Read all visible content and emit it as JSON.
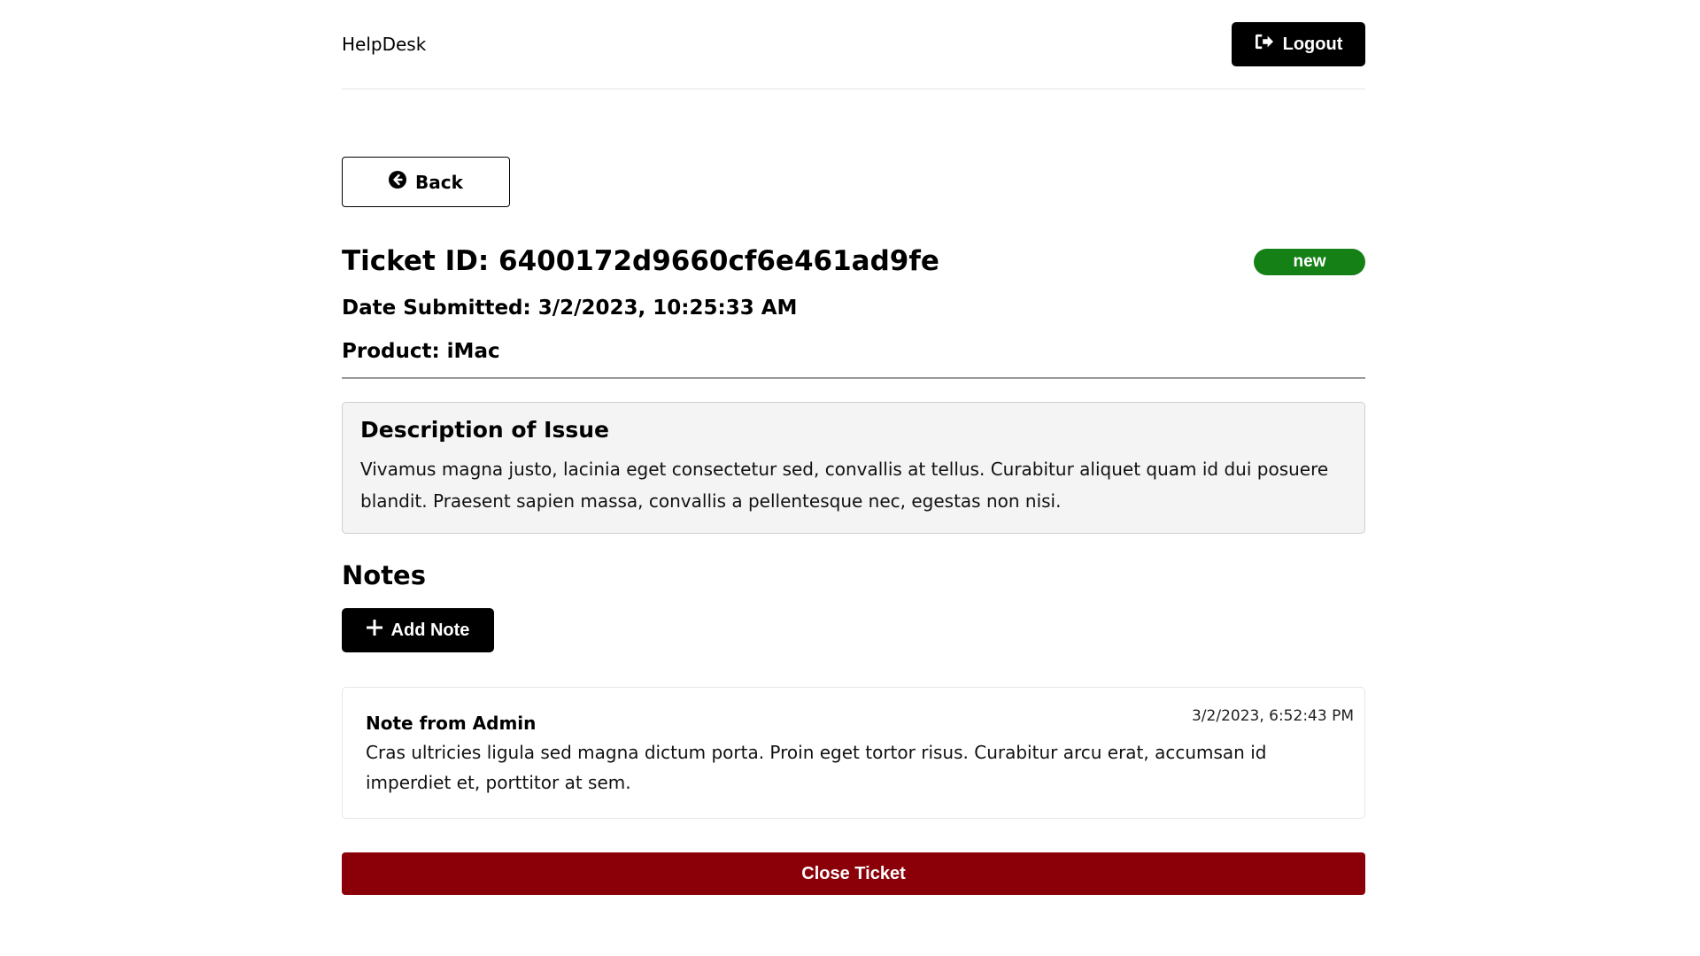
{
  "header": {
    "brand": "HelpDesk",
    "logout_label": "Logout",
    "logout_icon": "sign-out-icon"
  },
  "back": {
    "label": "Back",
    "icon": "arrow-circle-left-icon"
  },
  "ticket": {
    "id_text": "Ticket ID: 6400172d9660cf6e461ad9fe",
    "status": "new",
    "status_color": "#158016",
    "date_text": "Date Submitted: 3/2/2023, 10:25:33 AM",
    "product_text": "Product: iMac"
  },
  "description": {
    "title": "Description of Issue",
    "text": "Vivamus magna justo, lacinia eget consectetur sed, convallis at tellus. Curabitur aliquet quam id dui posuere blandit. Praesent sapien massa, convallis a pellentesque nec, egestas non nisi."
  },
  "notes": {
    "title": "Notes",
    "add_label": "Add Note",
    "add_icon": "plus-icon",
    "items": [
      {
        "author": "Note from Admin",
        "date": "3/2/2023, 6:52:43 PM",
        "text": "Cras ultricies ligula sed magna dictum porta. Proin eget tortor risus. Curabitur arcu erat, accumsan id imperdiet et, porttitor at sem."
      }
    ]
  },
  "close": {
    "label": "Close Ticket",
    "color": "#8b0008"
  }
}
